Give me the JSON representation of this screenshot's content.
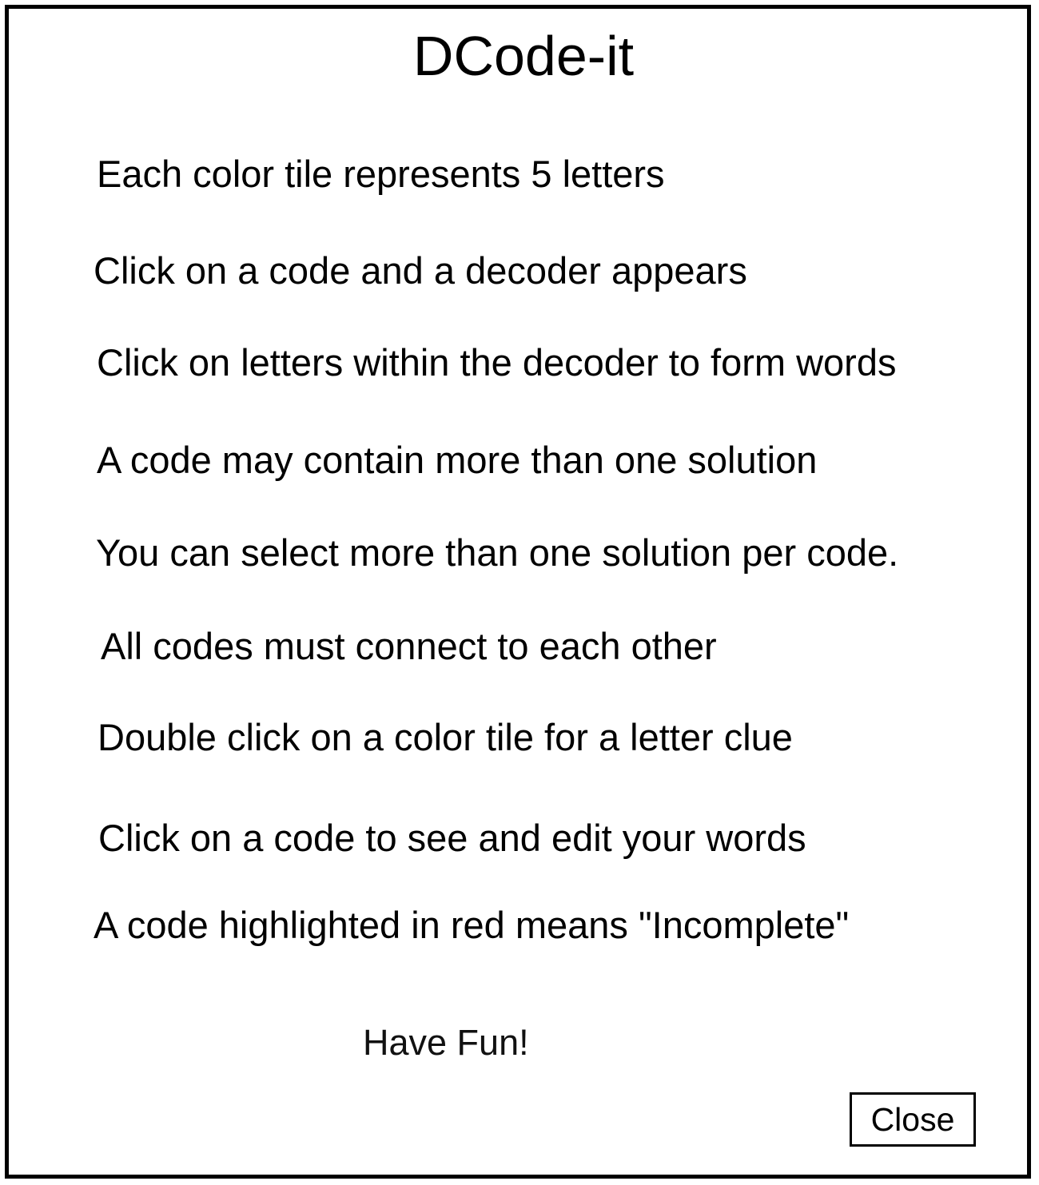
{
  "dialog": {
    "title": "DCode-it",
    "instructions": [
      "Each color tile represents 5 letters",
      "Click on a code and a decoder appears",
      "Click on letters within the decoder to form words",
      "A code may contain more than one solution",
      "You can select more than one solution per code.",
      "All codes must connect to each other",
      "Double click on a color tile for a letter clue",
      "Click on a code to see and edit your words",
      "A code highlighted in red means \"Incomplete\""
    ],
    "closing_message": "Have Fun!",
    "close_label": "Close"
  },
  "colors": {
    "border": "#000000",
    "background": "#ffffff",
    "text": "#000000"
  }
}
